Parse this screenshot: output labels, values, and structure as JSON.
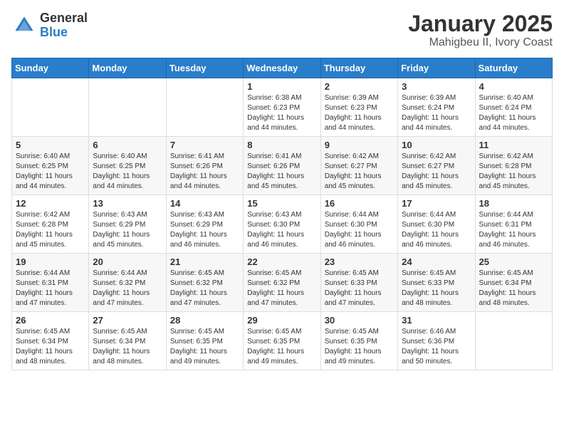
{
  "logo": {
    "general": "General",
    "blue": "Blue"
  },
  "title": "January 2025",
  "location": "Mahigbeu II, Ivory Coast",
  "days_of_week": [
    "Sunday",
    "Monday",
    "Tuesday",
    "Wednesday",
    "Thursday",
    "Friday",
    "Saturday"
  ],
  "weeks": [
    [
      {
        "day": "",
        "info": ""
      },
      {
        "day": "",
        "info": ""
      },
      {
        "day": "",
        "info": ""
      },
      {
        "day": "1",
        "info": "Sunrise: 6:38 AM\nSunset: 6:23 PM\nDaylight: 11 hours and 44 minutes."
      },
      {
        "day": "2",
        "info": "Sunrise: 6:39 AM\nSunset: 6:23 PM\nDaylight: 11 hours and 44 minutes."
      },
      {
        "day": "3",
        "info": "Sunrise: 6:39 AM\nSunset: 6:24 PM\nDaylight: 11 hours and 44 minutes."
      },
      {
        "day": "4",
        "info": "Sunrise: 6:40 AM\nSunset: 6:24 PM\nDaylight: 11 hours and 44 minutes."
      }
    ],
    [
      {
        "day": "5",
        "info": "Sunrise: 6:40 AM\nSunset: 6:25 PM\nDaylight: 11 hours and 44 minutes."
      },
      {
        "day": "6",
        "info": "Sunrise: 6:40 AM\nSunset: 6:25 PM\nDaylight: 11 hours and 44 minutes."
      },
      {
        "day": "7",
        "info": "Sunrise: 6:41 AM\nSunset: 6:26 PM\nDaylight: 11 hours and 44 minutes."
      },
      {
        "day": "8",
        "info": "Sunrise: 6:41 AM\nSunset: 6:26 PM\nDaylight: 11 hours and 45 minutes."
      },
      {
        "day": "9",
        "info": "Sunrise: 6:42 AM\nSunset: 6:27 PM\nDaylight: 11 hours and 45 minutes."
      },
      {
        "day": "10",
        "info": "Sunrise: 6:42 AM\nSunset: 6:27 PM\nDaylight: 11 hours and 45 minutes."
      },
      {
        "day": "11",
        "info": "Sunrise: 6:42 AM\nSunset: 6:28 PM\nDaylight: 11 hours and 45 minutes."
      }
    ],
    [
      {
        "day": "12",
        "info": "Sunrise: 6:42 AM\nSunset: 6:28 PM\nDaylight: 11 hours and 45 minutes."
      },
      {
        "day": "13",
        "info": "Sunrise: 6:43 AM\nSunset: 6:29 PM\nDaylight: 11 hours and 45 minutes."
      },
      {
        "day": "14",
        "info": "Sunrise: 6:43 AM\nSunset: 6:29 PM\nDaylight: 11 hours and 46 minutes."
      },
      {
        "day": "15",
        "info": "Sunrise: 6:43 AM\nSunset: 6:30 PM\nDaylight: 11 hours and 46 minutes."
      },
      {
        "day": "16",
        "info": "Sunrise: 6:44 AM\nSunset: 6:30 PM\nDaylight: 11 hours and 46 minutes."
      },
      {
        "day": "17",
        "info": "Sunrise: 6:44 AM\nSunset: 6:30 PM\nDaylight: 11 hours and 46 minutes."
      },
      {
        "day": "18",
        "info": "Sunrise: 6:44 AM\nSunset: 6:31 PM\nDaylight: 11 hours and 46 minutes."
      }
    ],
    [
      {
        "day": "19",
        "info": "Sunrise: 6:44 AM\nSunset: 6:31 PM\nDaylight: 11 hours and 47 minutes."
      },
      {
        "day": "20",
        "info": "Sunrise: 6:44 AM\nSunset: 6:32 PM\nDaylight: 11 hours and 47 minutes."
      },
      {
        "day": "21",
        "info": "Sunrise: 6:45 AM\nSunset: 6:32 PM\nDaylight: 11 hours and 47 minutes."
      },
      {
        "day": "22",
        "info": "Sunrise: 6:45 AM\nSunset: 6:32 PM\nDaylight: 11 hours and 47 minutes."
      },
      {
        "day": "23",
        "info": "Sunrise: 6:45 AM\nSunset: 6:33 PM\nDaylight: 11 hours and 47 minutes."
      },
      {
        "day": "24",
        "info": "Sunrise: 6:45 AM\nSunset: 6:33 PM\nDaylight: 11 hours and 48 minutes."
      },
      {
        "day": "25",
        "info": "Sunrise: 6:45 AM\nSunset: 6:34 PM\nDaylight: 11 hours and 48 minutes."
      }
    ],
    [
      {
        "day": "26",
        "info": "Sunrise: 6:45 AM\nSunset: 6:34 PM\nDaylight: 11 hours and 48 minutes."
      },
      {
        "day": "27",
        "info": "Sunrise: 6:45 AM\nSunset: 6:34 PM\nDaylight: 11 hours and 48 minutes."
      },
      {
        "day": "28",
        "info": "Sunrise: 6:45 AM\nSunset: 6:35 PM\nDaylight: 11 hours and 49 minutes."
      },
      {
        "day": "29",
        "info": "Sunrise: 6:45 AM\nSunset: 6:35 PM\nDaylight: 11 hours and 49 minutes."
      },
      {
        "day": "30",
        "info": "Sunrise: 6:45 AM\nSunset: 6:35 PM\nDaylight: 11 hours and 49 minutes."
      },
      {
        "day": "31",
        "info": "Sunrise: 6:46 AM\nSunset: 6:36 PM\nDaylight: 11 hours and 50 minutes."
      },
      {
        "day": "",
        "info": ""
      }
    ]
  ]
}
